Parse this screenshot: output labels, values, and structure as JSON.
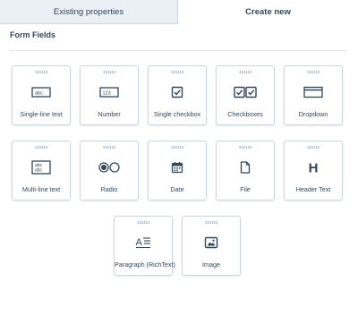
{
  "tabs": {
    "existing": "Existing properties",
    "create": "Create new"
  },
  "section": {
    "title": "Form Fields"
  },
  "fields": [
    {
      "label": "Single-line text",
      "icon": "single-line-text-icon",
      "sample": "abc"
    },
    {
      "label": "Number",
      "icon": "number-icon",
      "sample": "123"
    },
    {
      "label": "Single checkbox",
      "icon": "checkbox-icon"
    },
    {
      "label": "Checkboxes",
      "icon": "checkboxes-icon"
    },
    {
      "label": "Dropdown",
      "icon": "dropdown-icon"
    },
    {
      "label": "Multi-line text",
      "icon": "multi-line-text-icon",
      "sample": "abc"
    },
    {
      "label": "Radio",
      "icon": "radio-icon"
    },
    {
      "label": "Date",
      "icon": "calendar-icon"
    },
    {
      "label": "File",
      "icon": "file-icon"
    },
    {
      "label": "Header Text",
      "icon": "header-icon",
      "glyph": "H"
    },
    {
      "label": "Paragraph (RichText)",
      "icon": "paragraph-icon",
      "glyph": "A"
    },
    {
      "label": "Image",
      "icon": "image-icon"
    }
  ],
  "colors": {
    "text": "#33475b",
    "border": "#cbd6e2",
    "tab_inactive_bg": "#eaf0f6",
    "icon": "#33475b"
  }
}
